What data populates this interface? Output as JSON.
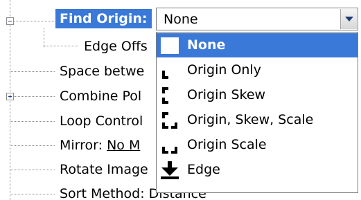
{
  "tree": {
    "find_origin_label": "Find Origin:",
    "edge_offset_label": "Edge Offs",
    "space_between_label": "Space betwe",
    "combine_label": "Combine Pol",
    "loop_control_label": "Loop Control",
    "mirror_label": "Mirror:",
    "mirror_value": "No M",
    "rotate_label": "Rotate Image",
    "sort_label": "Sort Method: Distance"
  },
  "combo": {
    "value": "None"
  },
  "options": [
    {
      "label": "None",
      "icon": "blank-origin-icon",
      "selected": true
    },
    {
      "label": "Origin Only",
      "icon": "origin-only-icon",
      "selected": false
    },
    {
      "label": "Origin  Skew",
      "icon": "origin-skew-icon",
      "selected": false
    },
    {
      "label": "Origin, Skew,  Scale",
      "icon": "origin-skew-scale-icon",
      "selected": false
    },
    {
      "label": "Origin  Scale",
      "icon": "origin-scale-icon",
      "selected": false
    },
    {
      "label": "Edge",
      "icon": "edge-arrow-icon",
      "selected": false
    }
  ],
  "colors": {
    "selection": "#3a79d8",
    "selection_text": "#ffffff",
    "tree_line": "#8a8a8a",
    "combo_arrow": "#1d3b73"
  }
}
